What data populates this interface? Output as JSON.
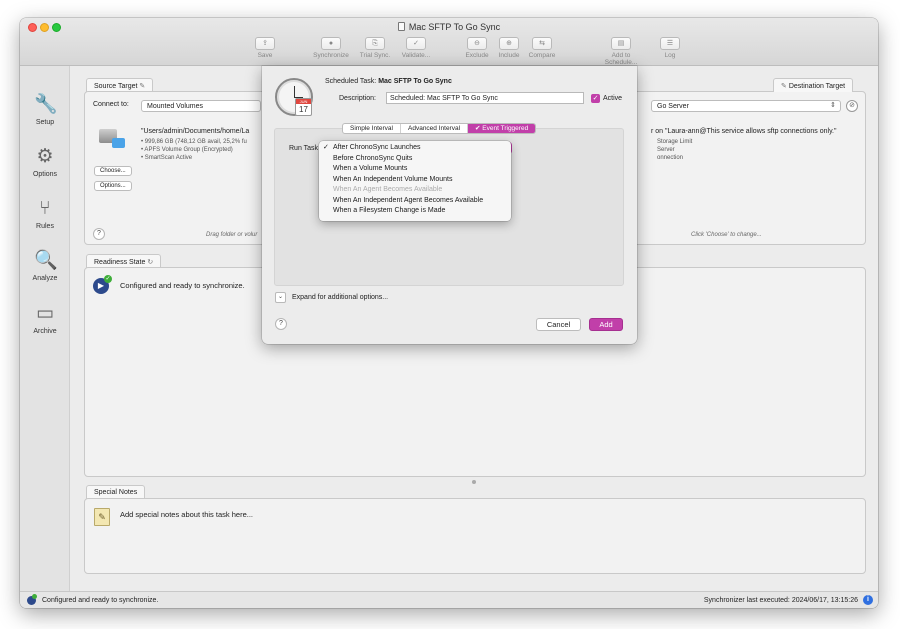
{
  "window": {
    "title": "Mac SFTP To Go Sync"
  },
  "toolbar": [
    {
      "label": "Save",
      "icon": "save-icon",
      "glyph": "⇪",
      "enabled": false
    },
    {
      "label": "Synchronize",
      "icon": "sync-icon",
      "glyph": "●",
      "enabled": false
    },
    {
      "label": "Trial Sync.",
      "icon": "trial-sync-icon",
      "glyph": "⎘",
      "enabled": false
    },
    {
      "label": "Validate...",
      "icon": "validate-icon",
      "glyph": "✓",
      "enabled": false
    },
    {
      "label": "Exclude",
      "icon": "exclude-icon",
      "glyph": "⊖",
      "enabled": false
    },
    {
      "label": "Include",
      "icon": "include-icon",
      "glyph": "⊕",
      "enabled": false
    },
    {
      "label": "Compare",
      "icon": "compare-icon",
      "glyph": "⇆",
      "enabled": false
    },
    {
      "label": "Add to Schedule...",
      "icon": "schedule-icon",
      "glyph": "▤",
      "enabled": false
    },
    {
      "label": "Log",
      "icon": "log-icon",
      "glyph": "☰",
      "enabled": false
    }
  ],
  "sidebar": [
    {
      "label": "Setup",
      "icon": "wrench-icon",
      "glyph": "🔧"
    },
    {
      "label": "Options",
      "icon": "gear-icon",
      "glyph": "⚙"
    },
    {
      "label": "Rules",
      "icon": "rules-icon",
      "glyph": "⑂"
    },
    {
      "label": "Analyze",
      "icon": "analyze-icon",
      "glyph": "🔍"
    },
    {
      "label": "Archive",
      "icon": "archive-icon",
      "glyph": "▭"
    }
  ],
  "source": {
    "tab": "Source Target",
    "connect_label": "Connect to:",
    "connect_value": "Mounted Volumes",
    "path": "\"Users/admin/Documents/home/La",
    "details": [
      "• 999,86 GB (748,12 GB avail, 25,2% fu",
      "• APFS Volume Group (Encrypted)",
      "• SmartScan Active"
    ],
    "choose_btn": "Choose...",
    "options_btn": "Options...",
    "drag_hint": "Drag folder or volur"
  },
  "destination": {
    "tab": "Destination Target",
    "connect_value": "Go Server",
    "path": "r on \"Laura-ann@This service allows sftp connections only.\"",
    "details": [
      "Storage Limit",
      "Server",
      "onnection"
    ],
    "hint": "Click 'Choose' to change..."
  },
  "readiness": {
    "tab": "Readiness State",
    "message": "Configured and ready to synchronize."
  },
  "notes": {
    "tab": "Special Notes",
    "placeholder": "Add special notes about this task here..."
  },
  "status": {
    "message": "Configured and ready to synchronize.",
    "last_executed": "Synchronizer last executed:  2024/06/17, 13:15:26"
  },
  "dialog": {
    "task_label": "Scheduled Task:",
    "task_name": "Mac SFTP To Go Sync",
    "description_label": "Description:",
    "description_value": "Scheduled: Mac SFTP To Go Sync",
    "active_label": "Active",
    "active": true,
    "calendar_month": "JUN",
    "calendar_day": "17",
    "tabs": [
      "Simple Interval",
      "Advanced Interval",
      "✔ Event Triggered"
    ],
    "active_tab": 2,
    "run_task_label": "Run Task",
    "expand_label": "Expand for additional options...",
    "cancel_btn": "Cancel",
    "add_btn": "Add"
  },
  "dropdown": {
    "selected_index": 0,
    "items": [
      {
        "label": "After ChronoSync Launches",
        "enabled": true
      },
      {
        "label": "Before ChronoSync Quits",
        "enabled": true
      },
      {
        "label": "When a Volume Mounts",
        "enabled": true
      },
      {
        "label": "When An Independent Volume Mounts",
        "enabled": true
      },
      {
        "label": "When An Agent Becomes Available",
        "enabled": false
      },
      {
        "label": "When An Independent Agent Becomes Available",
        "enabled": true
      },
      {
        "label": "When a Filesystem Change is Made",
        "enabled": true
      }
    ]
  },
  "colors": {
    "accent": "#c13fa9",
    "status_ok": "#3fae3a",
    "info": "#2f6fe0"
  }
}
